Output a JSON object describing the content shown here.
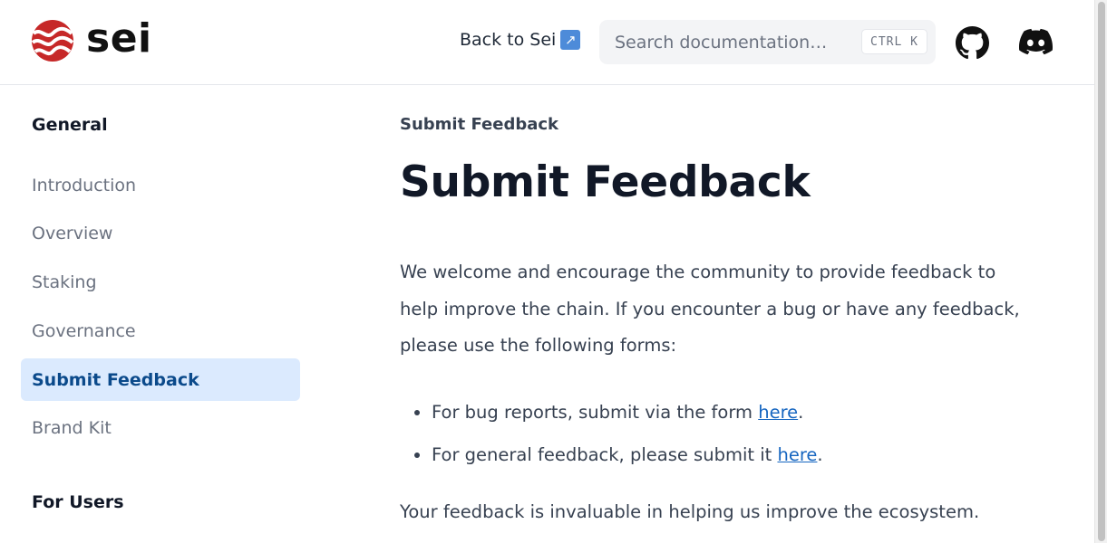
{
  "header": {
    "logo_text": "sei",
    "back_link": "Back to Sei",
    "external_icon": "↗",
    "search": {
      "placeholder": "Search documentation…",
      "shortcut": "CTRL K"
    },
    "icons": [
      "github-icon",
      "discord-icon"
    ]
  },
  "sidebar": {
    "sections": [
      {
        "title": "General"
      },
      {
        "title": "For Users"
      }
    ],
    "items": [
      {
        "label": "Introduction"
      },
      {
        "label": "Overview"
      },
      {
        "label": "Staking"
      },
      {
        "label": "Governance"
      },
      {
        "label": "Submit Feedback",
        "active": true
      },
      {
        "label": "Brand Kit"
      }
    ]
  },
  "main": {
    "breadcrumb": "Submit Feedback",
    "title": "Submit Feedback",
    "intro": "We welcome and encourage the community to provide feedback to help improve the chain. If you encounter a bug or have any feedback, please use the following forms:",
    "bullets": [
      {
        "text": "For bug reports, submit via the form ",
        "link": "here",
        "suffix": "."
      },
      {
        "text": "For general feedback, please submit it ",
        "link": "here",
        "suffix": "."
      }
    ],
    "outro": "Your feedback is invaluable in helping us improve the ecosystem."
  },
  "colors": {
    "brand_red": "#c62828",
    "active_bg": "#dbeafe",
    "active_text": "#0b4a8b",
    "link": "#1565c0"
  }
}
